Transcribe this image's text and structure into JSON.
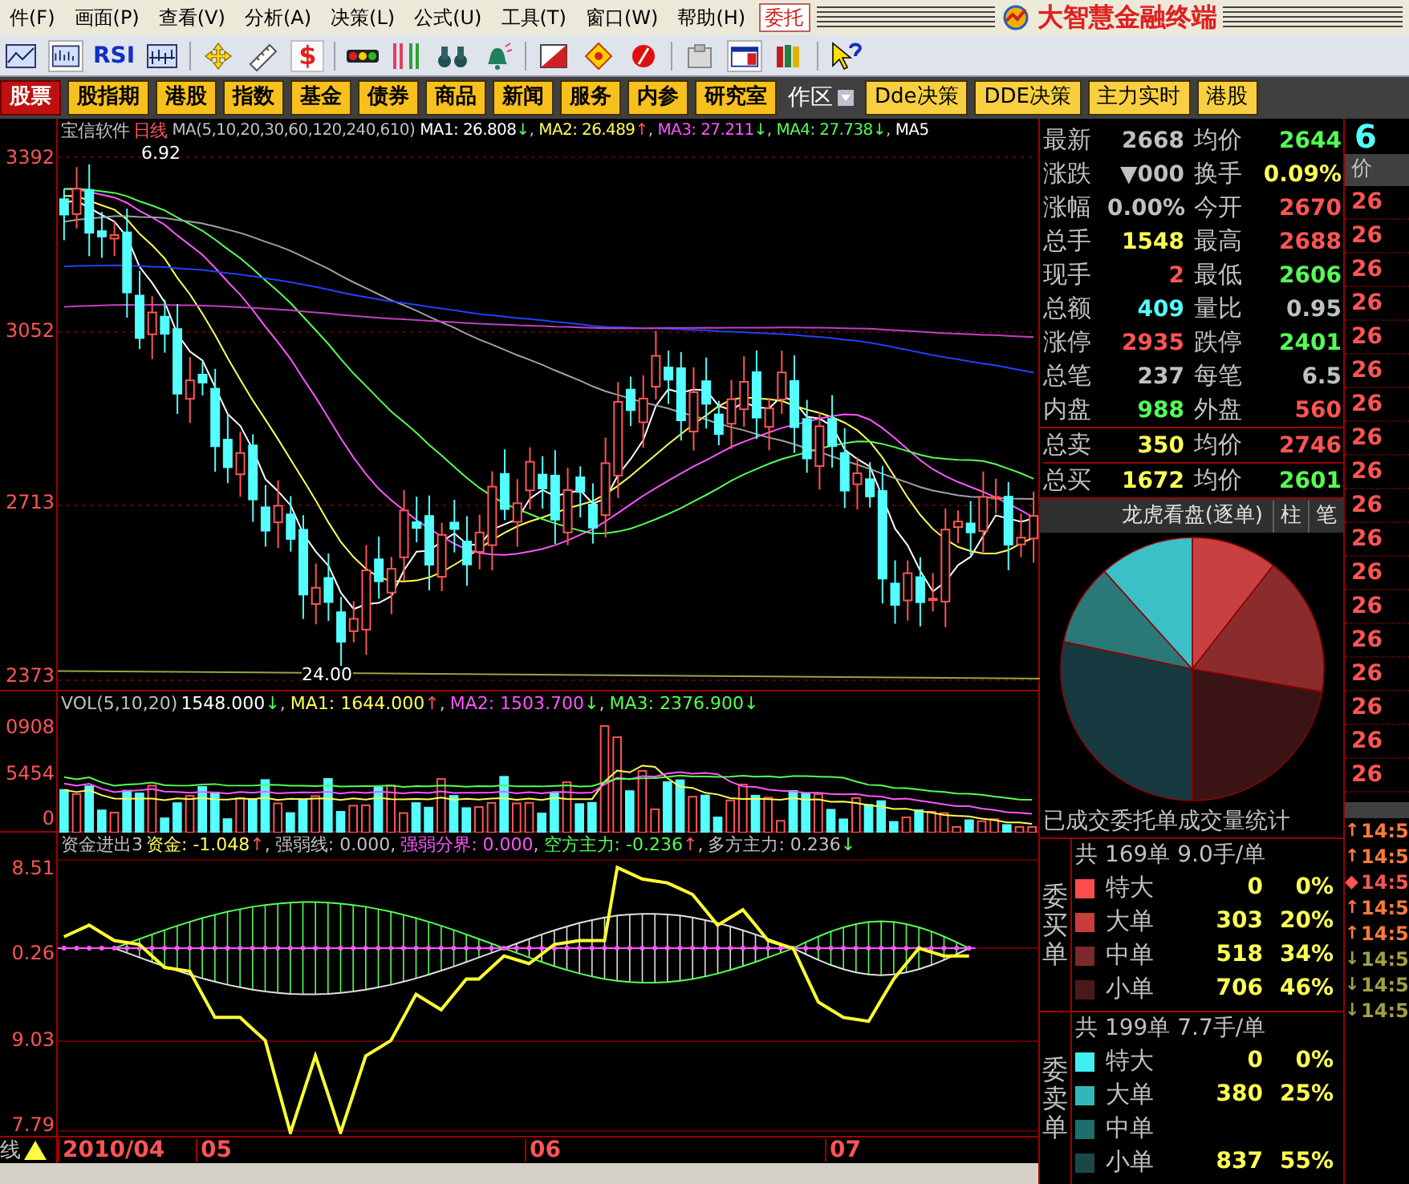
{
  "menu": {
    "items": [
      "件(F)",
      "画面(P)",
      "查看(V)",
      "分析(A)",
      "决策(L)",
      "公式(U)",
      "工具(T)",
      "窗口(W)",
      "帮助(H)"
    ],
    "trade_button": "委托",
    "app_title": "大智慧金融终端"
  },
  "toolbar": {
    "rsi_label": "RSI",
    "dollar_label": "$"
  },
  "nav": [
    {
      "label": "股票",
      "kind": "market",
      "selected": true
    },
    {
      "label": "股指期",
      "kind": "market",
      "selected": false
    },
    {
      "label": "港股",
      "kind": "market",
      "selected": false
    },
    {
      "label": "指数",
      "kind": "market",
      "selected": false
    },
    {
      "label": "基金",
      "kind": "market",
      "selected": false
    },
    {
      "label": "债券",
      "kind": "market",
      "selected": false
    },
    {
      "label": "商品",
      "kind": "market",
      "selected": false
    },
    {
      "label": "新闻",
      "kind": "market",
      "selected": false
    },
    {
      "label": "服务",
      "kind": "market",
      "selected": false
    },
    {
      "label": "内参",
      "kind": "market",
      "selected": false
    },
    {
      "label": "研究室",
      "kind": "market",
      "selected": false
    },
    {
      "label": "作区",
      "kind": "workspace",
      "selected": false
    },
    {
      "label": "Dde决策",
      "kind": "tool",
      "selected": false
    },
    {
      "label": "DDE决策",
      "kind": "tool",
      "selected": false
    },
    {
      "label": "主力实时",
      "kind": "tool",
      "selected": false
    },
    {
      "label": "港股",
      "kind": "tool",
      "selected": false
    }
  ],
  "price_chart": {
    "stock": "宝信软件",
    "period": "日线",
    "indicator": "MA(5,10,20,30,60,120,240,610)",
    "legend": [
      {
        "text": "MA1: 26.808",
        "arrow": {
          "text": "↓",
          "color": "#54ff54"
        },
        "color": "#ffffff",
        "sep": ","
      },
      {
        "text": "MA2: 26.489",
        "arrow": {
          "text": "↑",
          "color": "#ff5454"
        },
        "color": "#ffff54",
        "sep": ","
      },
      {
        "text": "MA3: 27.211",
        "arrow": {
          "text": "↓",
          "color": "#54ff54"
        },
        "color": "#ff54ff",
        "sep": ","
      },
      {
        "text": "MA4: 27.738",
        "arrow": {
          "text": "↓",
          "color": "#54ff54"
        },
        "color": "#54ff54",
        "sep": ","
      },
      {
        "text": "MA5",
        "color": "#ffffff"
      }
    ],
    "axis": [
      "3392",
      "3052",
      "2713",
      "2373"
    ],
    "high_mark": "6.92",
    "low_mark": "24.00"
  },
  "volume_chart": {
    "title": "VOL(5,10,20)",
    "legend": [
      {
        "text": "1548.000",
        "arrow": {
          "text": "↓",
          "color": "#54ff54"
        },
        "color": "#ffffff",
        "sep": ","
      },
      {
        "text": "MA1: 1644.000",
        "arrow": {
          "text": "↑",
          "color": "#ff5454"
        },
        "color": "#ffff54",
        "sep": ","
      },
      {
        "text": "MA2: 1503.700",
        "arrow": {
          "text": "↓",
          "color": "#54ff54"
        },
        "color": "#ff54ff",
        "sep": ","
      },
      {
        "text": "MA3: 2376.900",
        "arrow": {
          "text": "↓",
          "color": "#54ff54"
        },
        "color": "#54ff54"
      }
    ],
    "axis": [
      "0908",
      "5454",
      "0"
    ]
  },
  "capital_chart": {
    "title": "资金进出3",
    "legend": [
      {
        "text": "资金: -1.048",
        "arrow": {
          "text": "↑",
          "color": "#ff5454"
        },
        "color": "#ffff54",
        "sep": ","
      },
      {
        "text": "强弱线: 0.000",
        "color": "#c0c0c0",
        "sep": ","
      },
      {
        "text": "强弱分界: 0.000",
        "color": "#ff54ff",
        "sep": ","
      },
      {
        "text": "空方主力: -0.236",
        "arrow": {
          "text": "↑",
          "color": "#ff5454"
        },
        "color": "#54ff54",
        "sep": ","
      },
      {
        "text": "多方主力: 0.236",
        "arrow": {
          "text": "↓",
          "color": "#54ff54"
        },
        "color": "#c0c0c0"
      }
    ],
    "axis": [
      "8.51",
      "0.26",
      "9.03",
      "7.79"
    ]
  },
  "date_axis": {
    "period_label": "线",
    "labels": [
      "2010/04",
      "05",
      "06",
      "07"
    ]
  },
  "quote": {
    "rows": [
      [
        {
          "label": "最新",
          "value": "2668",
          "color": "#c0c0c0"
        },
        {
          "label": "均价",
          "value": "2644",
          "color": "#54ff54"
        }
      ],
      [
        {
          "label": "涨跌",
          "value": "▼000",
          "color": "#c0c0c0"
        },
        {
          "label": "换手",
          "value": "0.09%",
          "color": "#ffff54"
        }
      ],
      [
        {
          "label": "涨幅",
          "value": "0.00%",
          "color": "#c0c0c0"
        },
        {
          "label": "今开",
          "value": "2670",
          "color": "#ff5454"
        }
      ],
      [
        {
          "label": "总手",
          "value": "1548",
          "color": "#ffff54"
        },
        {
          "label": "最高",
          "value": "2688",
          "color": "#ff5454"
        }
      ],
      [
        {
          "label": "现手",
          "value": "2",
          "color": "#ff5454"
        },
        {
          "label": "最低",
          "value": "2606",
          "color": "#54ff54"
        }
      ],
      [
        {
          "label": "总额",
          "value": "409",
          "color": "#54ffff"
        },
        {
          "label": "量比",
          "value": "0.95",
          "color": "#c0c0c0"
        }
      ],
      [
        {
          "label": "涨停",
          "value": "2935",
          "color": "#ff5454"
        },
        {
          "label": "跌停",
          "value": "2401",
          "color": "#54ff54"
        }
      ],
      [
        {
          "label": "总笔",
          "value": "237",
          "color": "#c0c0c0"
        },
        {
          "label": "每笔",
          "value": "6.5",
          "color": "#c0c0c0"
        }
      ],
      [
        {
          "label": "内盘",
          "value": "988",
          "color": "#54ff54"
        },
        {
          "label": "外盘",
          "value": "560",
          "color": "#ff5454"
        }
      ]
    ],
    "totals": [
      [
        {
          "label": "总卖",
          "value": "350",
          "color": "#ffff54"
        },
        {
          "label": "均价",
          "value": "2746",
          "color": "#ff5454"
        }
      ],
      [
        {
          "label": "总买",
          "value": "1672",
          "color": "#ffff54"
        },
        {
          "label": "均价",
          "value": "2601",
          "color": "#54ff54"
        }
      ]
    ]
  },
  "orders": {
    "title": "龙虎看盘(逐单)",
    "tabs": [
      "柱",
      "笔"
    ],
    "caption": "已成交委托单成交量统计",
    "buy": {
      "side_label": "委买单",
      "summary": "共 169单 9.0手/单",
      "rows": [
        {
          "label": "特大",
          "count": "0",
          "percent": "0%",
          "color": "#ff4d4d"
        },
        {
          "label": "大单",
          "count": "303",
          "percent": "20%",
          "color": "#c83c3c"
        },
        {
          "label": "中单",
          "count": "518",
          "percent": "34%",
          "color": "#7a2a2a"
        },
        {
          "label": "小单",
          "count": "706",
          "percent": "46%",
          "color": "#4a1a1a"
        }
      ]
    },
    "sell": {
      "side_label": "委卖单",
      "summary": "共 199单 7.7手/单",
      "rows": [
        {
          "label": "特大",
          "count": "0",
          "percent": "0%",
          "color": "#40f0f0"
        },
        {
          "label": "大单",
          "count": "380",
          "percent": "25%",
          "color": "#30b8b8"
        },
        {
          "label": "中单",
          "color": "#1e6e6e"
        },
        {
          "label": "小单",
          "count": "837",
          "percent": "55%",
          "color": "#1a4848"
        }
      ]
    }
  },
  "ticker": {
    "code": "6",
    "header": "价",
    "prices": [
      "26",
      "26",
      "26",
      "26",
      "26",
      "26",
      "26",
      "26",
      "26",
      "26",
      "26",
      "26",
      "26",
      "26",
      "26",
      "26",
      "26",
      "26"
    ],
    "ticks": [
      {
        "mark": "↑",
        "time": "14:5",
        "color": "#ff7a3a"
      },
      {
        "mark": "↑",
        "time": "14:5",
        "color": "#ff7a3a"
      },
      {
        "mark": "◆",
        "time": "14:5",
        "color": "#ff5454"
      },
      {
        "mark": "↑",
        "time": "14:5",
        "color": "#ff7a3a"
      },
      {
        "mark": "↑",
        "time": "14:5",
        "color": "#ff7a3a"
      },
      {
        "mark": "↓",
        "time": "14:5",
        "color": "#a0a040"
      },
      {
        "mark": "↓",
        "time": "14:5",
        "color": "#a0a040"
      },
      {
        "mark": "↓",
        "time": "14:5",
        "color": "#a0a040"
      }
    ]
  }
}
